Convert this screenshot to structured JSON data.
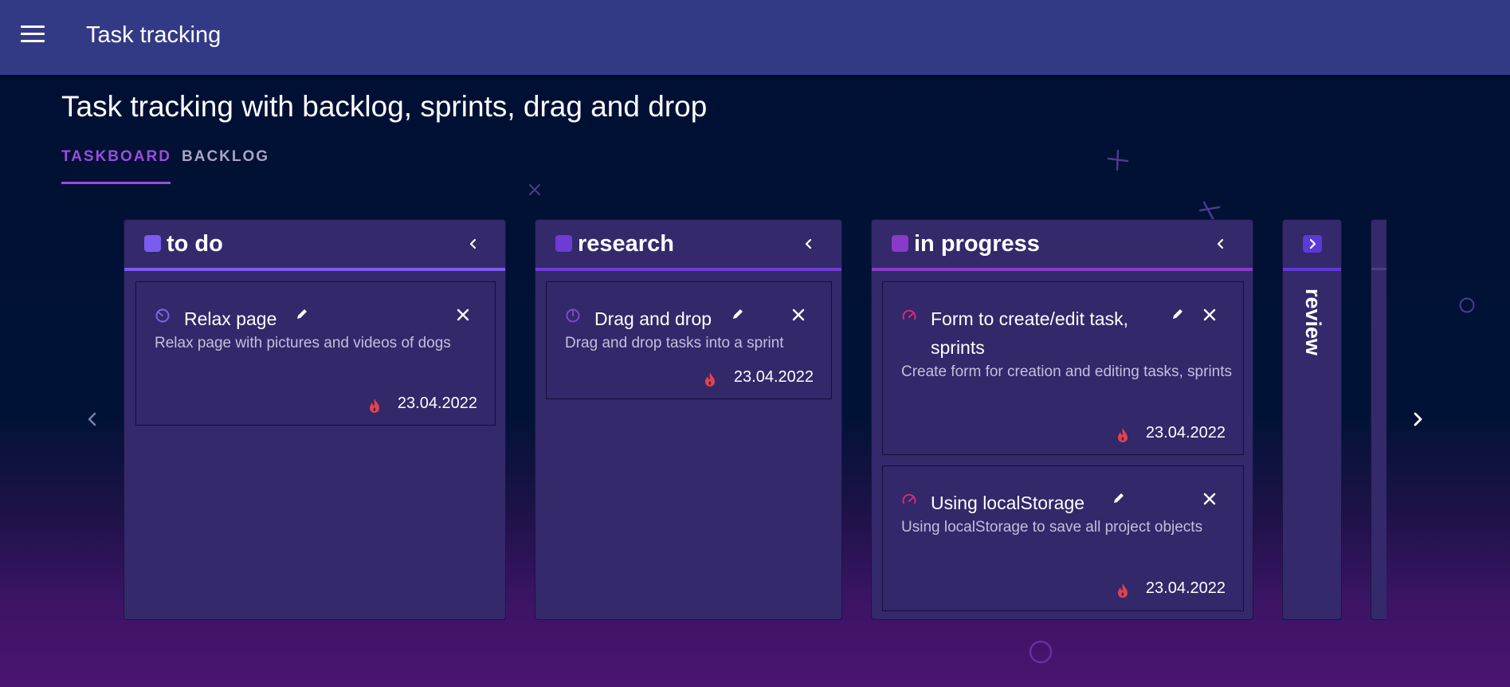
{
  "appbar": {
    "title": "Task tracking",
    "menu_icon": "menu-icon"
  },
  "page": {
    "title": "Task tracking with backlog, sprints, drag and drop"
  },
  "tabs": [
    {
      "label": "TASKBOARD",
      "active": true
    },
    {
      "label": "BACKLOG",
      "active": false
    }
  ],
  "colors": {
    "appbar": "#333a85",
    "accent": "#9b4ddd",
    "column": "#33296b",
    "due_icon": "#e3424b"
  },
  "columns": [
    {
      "title": "to do",
      "color": "#7b5cf0",
      "collapsed": false,
      "cards": [
        {
          "title": "Relax page",
          "description": "Relax page with pictures and videos of dogs",
          "date": "23.04.2022",
          "priority_color": "#7b66e6"
        }
      ]
    },
    {
      "title": "research",
      "color": "#6f3bd6",
      "collapsed": false,
      "cards": [
        {
          "title": "Drag and drop",
          "description": "Drag and drop tasks into a sprint",
          "date": "23.04.2022",
          "priority_color": "#7a4cc8"
        }
      ]
    },
    {
      "title": "in progress",
      "color": "#8a3ac8",
      "collapsed": false,
      "cards": [
        {
          "title": "Form to create/edit task, sprints",
          "description": "Create form for creation and editing tasks, sprints",
          "date": "23.04.2022",
          "priority_color": "#d62a7c"
        },
        {
          "title": "Using localStorage",
          "description": "Using localStorage to save all project objects",
          "date": "23.04.2022",
          "priority_color": "#d62a7c"
        }
      ]
    },
    {
      "title": "review",
      "color": "#5b3ad6",
      "collapsed": true,
      "cards": []
    }
  ]
}
